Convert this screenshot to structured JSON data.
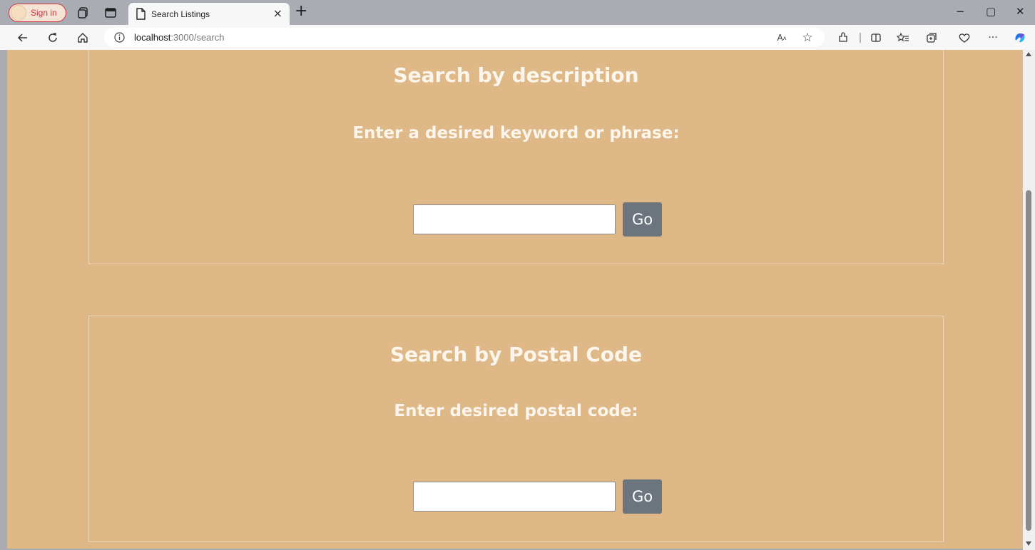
{
  "browser": {
    "profile_label": "Sign in",
    "tab_title": "Search Listings",
    "tab_close": "×",
    "new_tab": "+",
    "url_host": "localhost",
    "url_path": ":3000/search",
    "window_minimize": "−",
    "window_restore": "▢",
    "window_close": "✕",
    "more_label": "···"
  },
  "page": {
    "background": "#deb887",
    "description_section": {
      "title": "Search by description",
      "prompt": "Enter a desired keyword or phrase:",
      "input_value": "",
      "button_label": "Go"
    },
    "postal_section": {
      "title": "Search by Postal Code",
      "prompt": "Enter desired postal code:",
      "input_value": "",
      "button_label": "Go"
    }
  },
  "colors": {
    "accent_button": "#6c757d",
    "profile_accent": "#d1343d"
  }
}
